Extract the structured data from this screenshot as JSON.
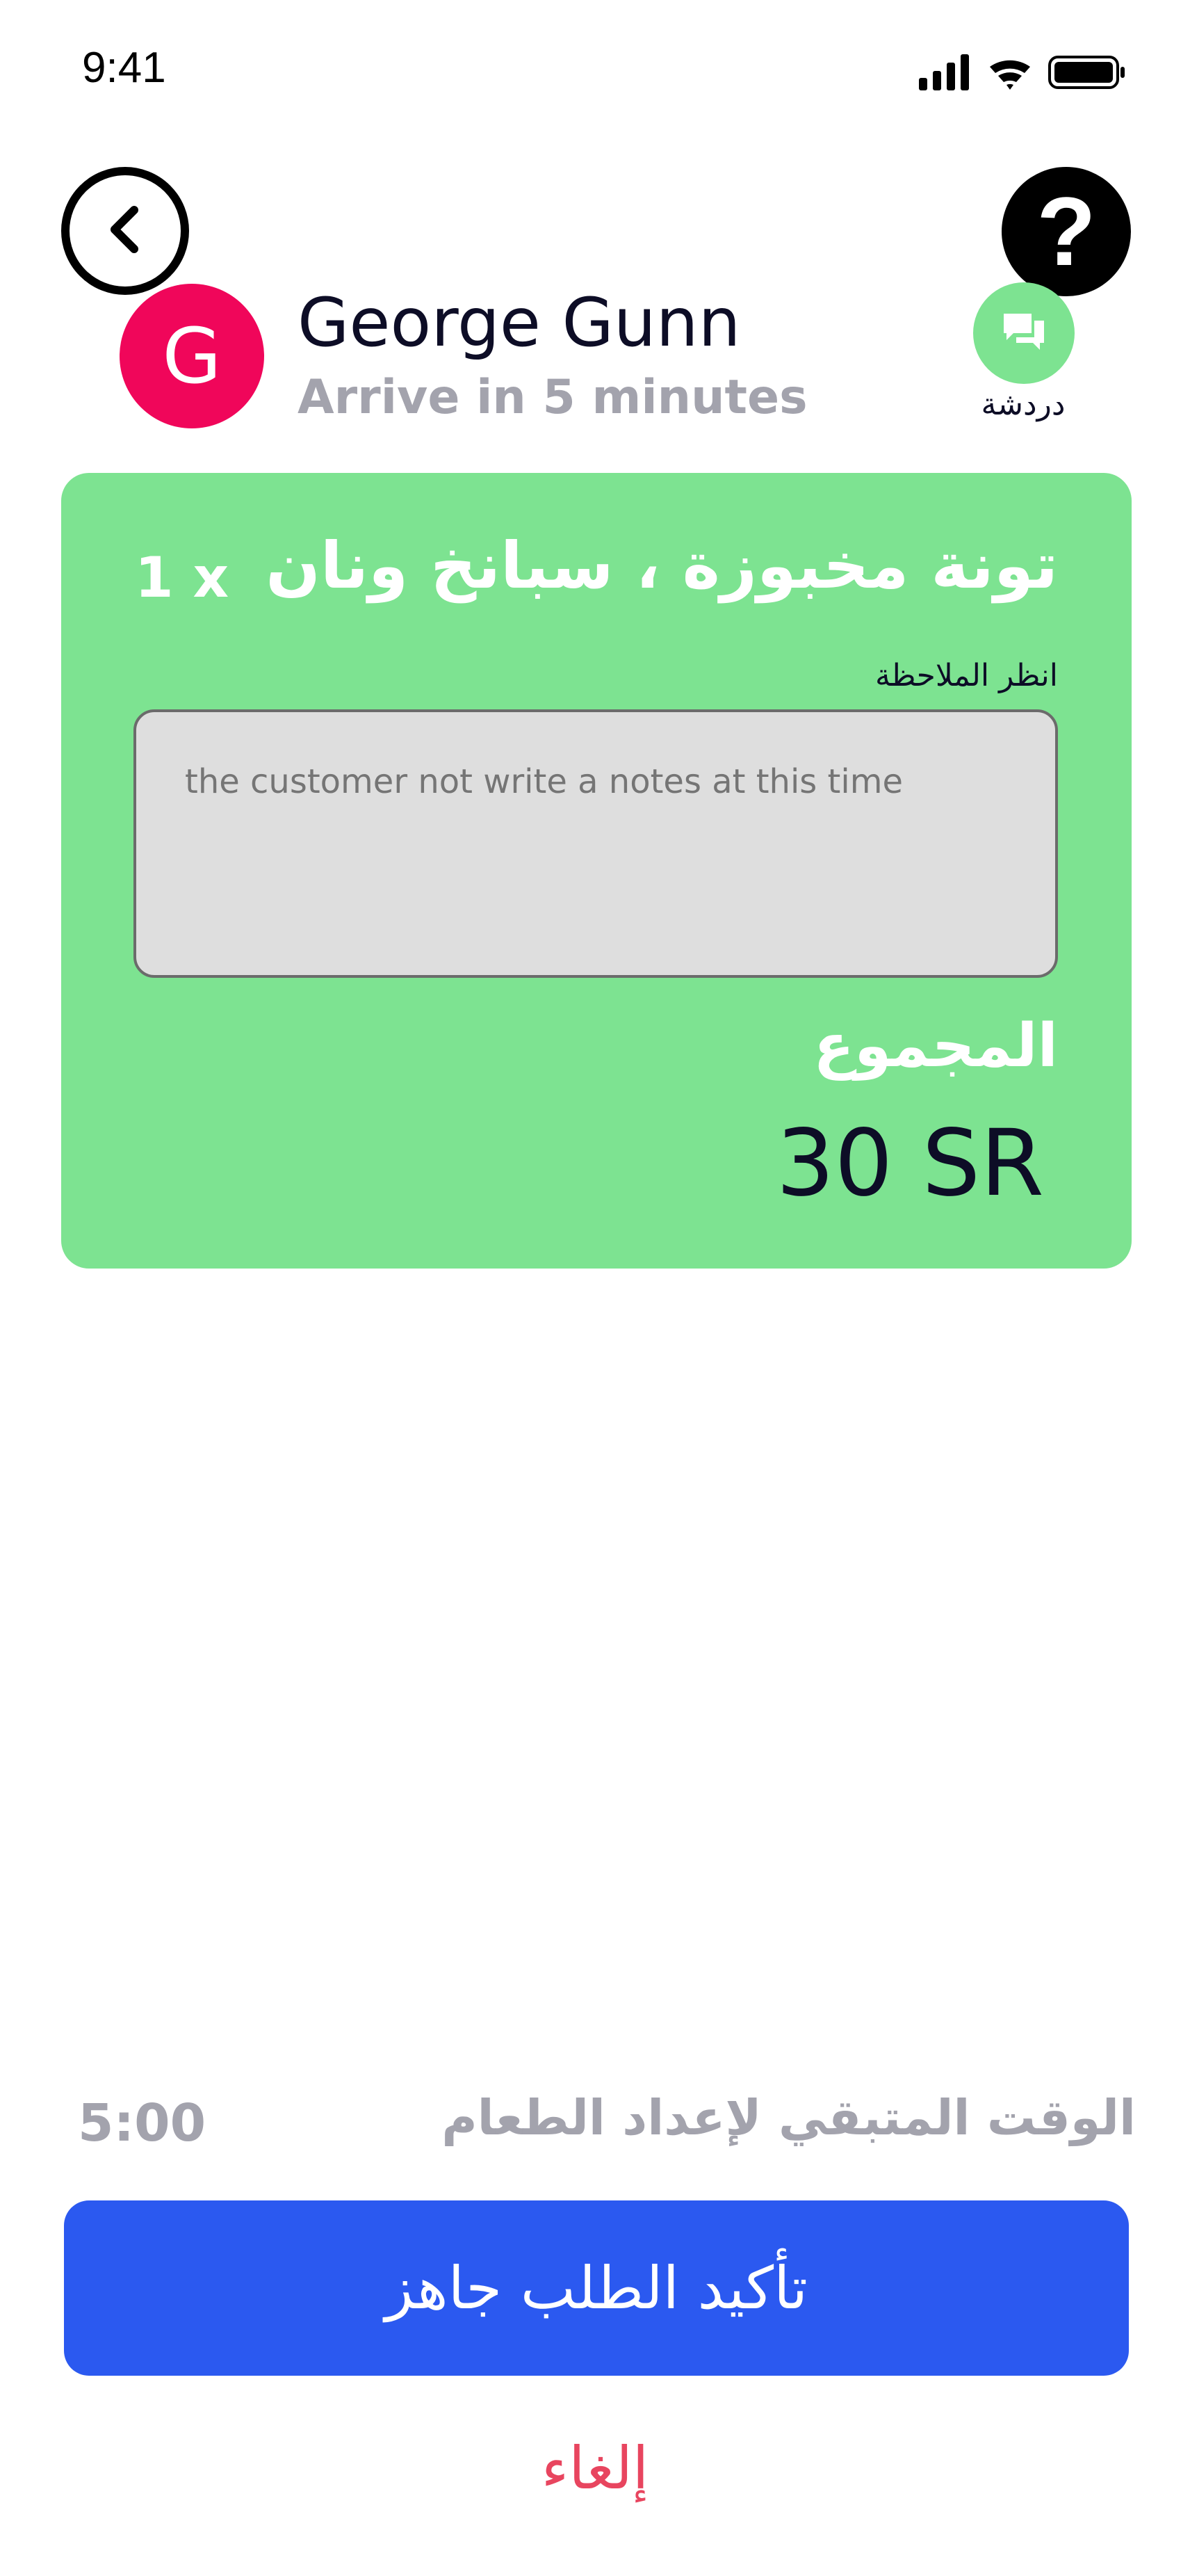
{
  "status_bar": {
    "time": "9:41",
    "icons": [
      "cellular-signal-icon",
      "wifi-icon",
      "battery-icon"
    ]
  },
  "header": {
    "back_icon": "chevron-left-icon",
    "help_icon": "question-mark-icon",
    "help_glyph": "?"
  },
  "customer": {
    "initial": "G",
    "name": "George Gunn",
    "arrival": "Arrive in 5 minutes",
    "avatar_color": "#f0065a",
    "chat_icon": "chat-bubbles-icon",
    "chat_label": "دردشة"
  },
  "order": {
    "item_name": "تونة مخبوزة ، سبانخ ونان",
    "quantity": "1 x",
    "note_label": "انظر الملاحظة",
    "note_placeholder": "the customer not write a notes at this time",
    "total_label": "المجموع",
    "total_value": "30 SR",
    "card_color": "#7de391"
  },
  "timer": {
    "label": "الوقت المتبقي لإعداد الطعام",
    "value": "5:00"
  },
  "actions": {
    "confirm_label": "تأكيد الطلب جاهز",
    "confirm_color": "#2b59f0",
    "cancel_label": "إلغاء",
    "cancel_color": "#e8455f"
  }
}
